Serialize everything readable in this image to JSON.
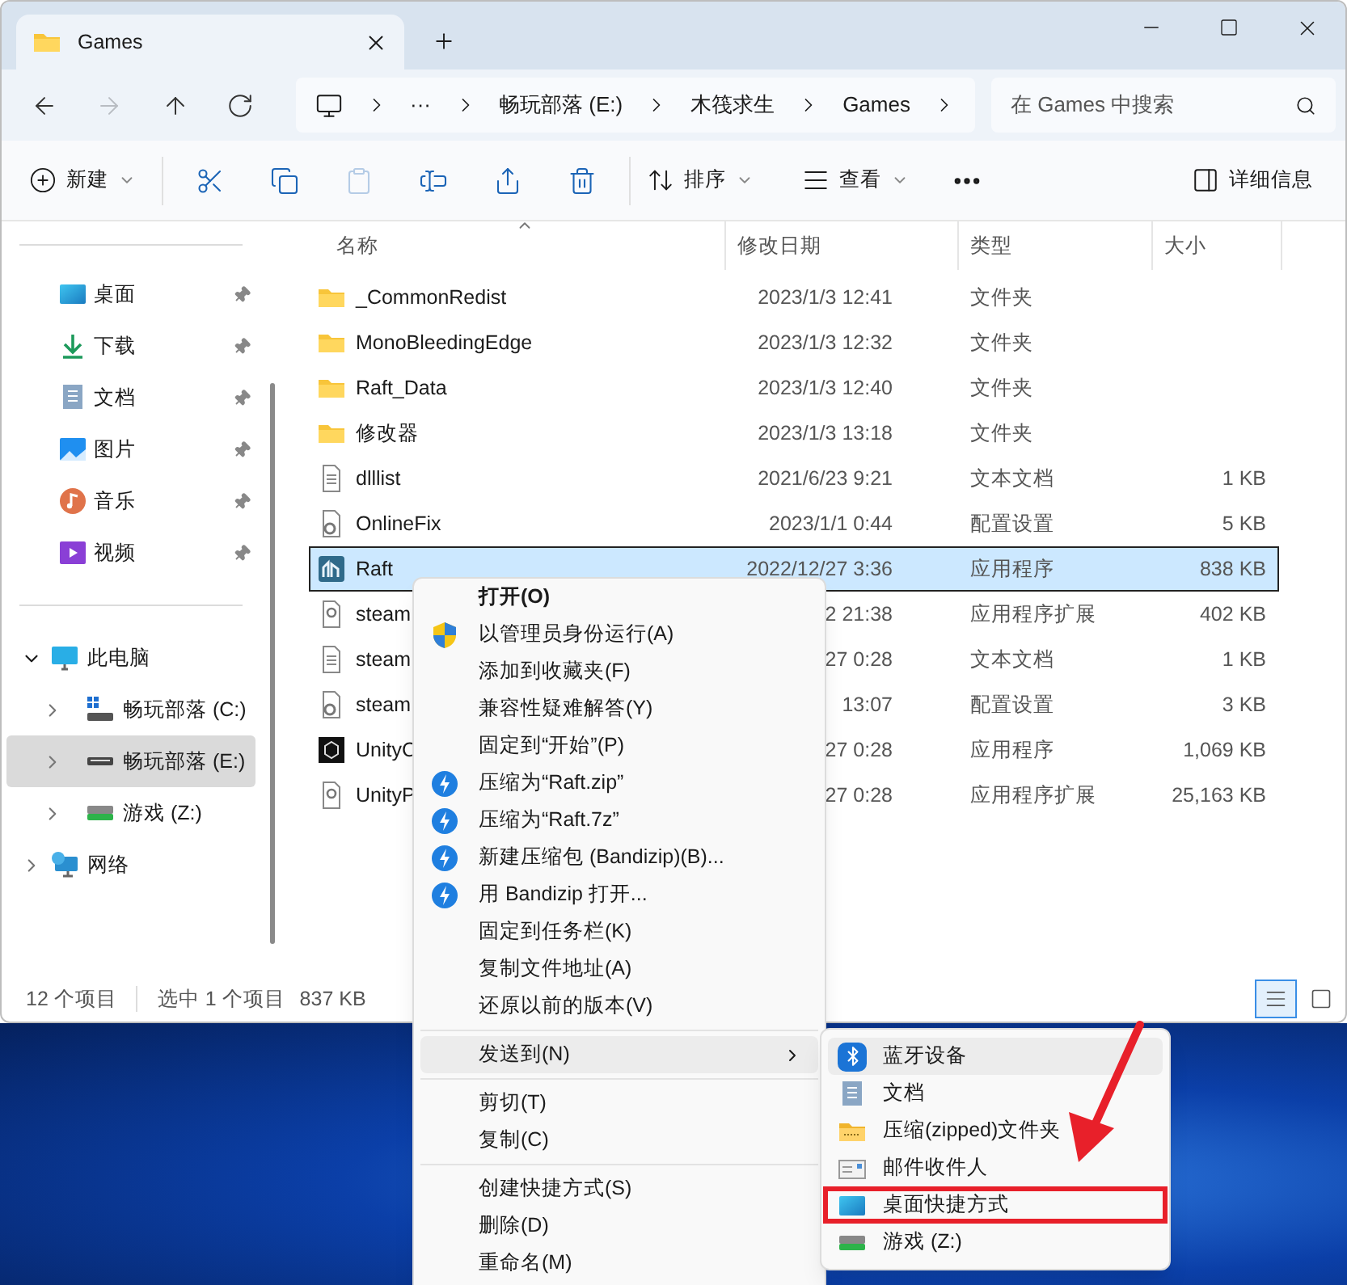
{
  "window": {
    "tab": {
      "title": "Games"
    }
  },
  "nav": {
    "buttons": [
      {
        "kind": "back",
        "disabled": false
      },
      {
        "kind": "forward",
        "disabled": true
      },
      {
        "kind": "up",
        "disabled": false
      },
      {
        "kind": "refresh",
        "disabled": false
      }
    ],
    "breadcrumb": [
      "···",
      "畅玩部落 (E:)",
      "木筏求生",
      "Games"
    ]
  },
  "search": {
    "placeholder": "在 Games 中搜索"
  },
  "toolbar": {
    "new": "新建",
    "actions": [
      {
        "kind": "cut",
        "disabled": false
      },
      {
        "kind": "copy",
        "disabled": false
      },
      {
        "kind": "paste",
        "disabled": true
      },
      {
        "kind": "rename",
        "disabled": false
      },
      {
        "kind": "share",
        "disabled": false
      },
      {
        "kind": "delete",
        "disabled": false
      }
    ],
    "sort": "排序",
    "view": "查看",
    "details": "详细信息"
  },
  "sidebar": {
    "quick_access": [
      {
        "label": "桌面",
        "kind": "desktop",
        "pinned": true
      },
      {
        "label": "下载",
        "kind": "download",
        "pinned": true
      },
      {
        "label": "文档",
        "kind": "document",
        "pinned": true
      },
      {
        "label": "图片",
        "kind": "picture",
        "pinned": true
      },
      {
        "label": "音乐",
        "kind": "music",
        "pinned": true
      },
      {
        "label": "视频",
        "kind": "video",
        "pinned": true
      }
    ],
    "tree": [
      {
        "label": "此电脑",
        "kind": "pc",
        "expanded": true,
        "selected": false,
        "children": [
          {
            "label": "畅玩部落 (C:)",
            "kind": "system-drive",
            "expanded": false,
            "selected": false
          },
          {
            "label": "畅玩部落 (E:)",
            "kind": "drive",
            "expanded": false,
            "selected": true
          },
          {
            "label": "游戏 (Z:)",
            "kind": "game-drive",
            "expanded": false,
            "selected": false
          }
        ]
      },
      {
        "label": "网络",
        "kind": "network",
        "expanded": false,
        "selected": false
      }
    ]
  },
  "table": {
    "columns": [
      {
        "label": "名称",
        "sorted": true
      },
      {
        "label": "修改日期",
        "sorted": false
      },
      {
        "label": "类型",
        "sorted": false
      },
      {
        "label": "大小",
        "sorted": false
      }
    ],
    "rows": [
      {
        "name": "_CommonRedist",
        "date": "2023/1/3 12:41",
        "type": "文件夹",
        "kind": "folder",
        "selected": false
      },
      {
        "name": "MonoBleedingEdge",
        "date": "2023/1/3 12:32",
        "type": "文件夹",
        "kind": "folder",
        "selected": false
      },
      {
        "name": "Raft_Data",
        "date": "2023/1/3 12:40",
        "type": "文件夹",
        "kind": "folder",
        "selected": false
      },
      {
        "name": "修改器",
        "date": "2023/1/3 13:18",
        "type": "文件夹",
        "kind": "folder",
        "selected": false
      },
      {
        "name": "dlllist",
        "date": "2021/6/23 9:21",
        "type": "文本文档",
        "size": "1 KB",
        "kind": "text",
        "selected": false
      },
      {
        "name": "OnlineFix",
        "date": "2023/1/1 0:44",
        "type": "配置设置",
        "size": "5 KB",
        "kind": "config",
        "selected": false
      },
      {
        "name": "Raft",
        "date": "2022/12/27 3:36",
        "type": "应用程序",
        "size": "838 KB",
        "kind": "app",
        "selected": true
      },
      {
        "name": "steam",
        "date": "2 21:38",
        "type": "应用程序扩展",
        "size": "402 KB",
        "kind": "extension",
        "selected": false
      },
      {
        "name": "steam",
        "date": "27 0:28",
        "type": "文本文档",
        "size": "1 KB",
        "kind": "text",
        "selected": false
      },
      {
        "name": "steam",
        "date": "13:07",
        "type": "配置设置",
        "size": "3 KB",
        "kind": "config",
        "selected": false
      },
      {
        "name": "UnityC",
        "date": "27 0:28",
        "type": "应用程序",
        "size": "1,069 KB",
        "kind": "unity",
        "selected": false
      },
      {
        "name": "UnityP",
        "date": "27 0:28",
        "type": "应用程序扩展",
        "size": "25,163 KB",
        "kind": "extension",
        "selected": false
      }
    ]
  },
  "status_bar": {
    "count": "12 个项目",
    "selection": "选中 1 个项目",
    "size": "837 KB",
    "view_buttons": [
      {
        "kind": "details",
        "selected": true
      },
      {
        "kind": "tiles",
        "selected": false
      }
    ]
  },
  "context_menu": {
    "groups": [
      [
        {
          "label": "打开(O)",
          "kind": "plain",
          "default": true,
          "submenu": false,
          "selected": false
        },
        {
          "label": "以管理员身份运行(A)",
          "kind": "shield",
          "default": false,
          "submenu": false,
          "selected": false
        },
        {
          "label": "添加到收藏夹(F)",
          "kind": "plain",
          "default": false,
          "submenu": false,
          "selected": false
        },
        {
          "label": "兼容性疑难解答(Y)",
          "kind": "plain",
          "default": false,
          "submenu": false,
          "selected": false
        },
        {
          "label": "固定到“开始”(P)",
          "kind": "plain",
          "default": false,
          "submenu": false,
          "selected": false
        },
        {
          "label": "压缩为“Raft.zip”",
          "kind": "bandizip",
          "default": false,
          "submenu": false,
          "selected": false
        },
        {
          "label": "压缩为“Raft.7z”",
          "kind": "bandizip",
          "default": false,
          "submenu": false,
          "selected": false
        },
        {
          "label": "新建压缩包 (Bandizip)(B)...",
          "kind": "bandizip",
          "default": false,
          "submenu": false,
          "selected": false
        },
        {
          "label": "用 Bandizip 打开...",
          "kind": "bandizip",
          "default": false,
          "submenu": false,
          "selected": false
        },
        {
          "label": "固定到任务栏(K)",
          "kind": "plain",
          "default": false,
          "submenu": false,
          "selected": false
        },
        {
          "label": "复制文件地址(A)",
          "kind": "plain",
          "default": false,
          "submenu": false,
          "selected": false
        },
        {
          "label": "还原以前的版本(V)",
          "kind": "plain",
          "default": false,
          "submenu": false,
          "selected": false
        }
      ],
      [
        {
          "label": "发送到(N)",
          "kind": "plain",
          "default": false,
          "submenu": true,
          "selected": true
        }
      ],
      [
        {
          "label": "剪切(T)",
          "kind": "plain",
          "default": false,
          "submenu": false,
          "selected": false
        },
        {
          "label": "复制(C)",
          "kind": "plain",
          "default": false,
          "submenu": false,
          "selected": false
        }
      ],
      [
        {
          "label": "创建快捷方式(S)",
          "kind": "plain",
          "default": false,
          "submenu": false,
          "selected": false
        },
        {
          "label": "删除(D)",
          "kind": "plain",
          "default": false,
          "submenu": false,
          "selected": false
        },
        {
          "label": "重命名(M)",
          "kind": "plain",
          "default": false,
          "submenu": false,
          "selected": false
        }
      ]
    ]
  },
  "send_to_menu": {
    "items": [
      {
        "label": "蓝牙设备",
        "kind": "bluetooth",
        "selected": true,
        "highlighted": false
      },
      {
        "label": "文档",
        "kind": "document",
        "selected": false,
        "highlighted": false
      },
      {
        "label": "压缩(zipped)文件夹",
        "kind": "zip-folder",
        "selected": false,
        "highlighted": false
      },
      {
        "label": "邮件收件人",
        "kind": "mail",
        "selected": false,
        "highlighted": false
      },
      {
        "label": "桌面快捷方式",
        "kind": "desktop",
        "selected": false,
        "highlighted": true
      },
      {
        "label": "游戏 (Z:)",
        "kind": "game-drive",
        "selected": false,
        "highlighted": false
      }
    ]
  }
}
